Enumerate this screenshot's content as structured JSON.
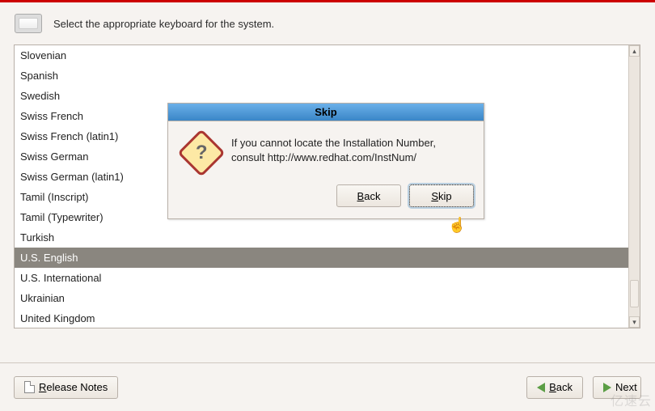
{
  "header": {
    "text": "Select the appropriate keyboard for the system."
  },
  "keyboard_list": {
    "items": [
      {
        "label": "Slovenian",
        "selected": false
      },
      {
        "label": "Spanish",
        "selected": false
      },
      {
        "label": "Swedish",
        "selected": false
      },
      {
        "label": "Swiss French",
        "selected": false
      },
      {
        "label": "Swiss French (latin1)",
        "selected": false
      },
      {
        "label": "Swiss German",
        "selected": false
      },
      {
        "label": "Swiss German (latin1)",
        "selected": false
      },
      {
        "label": "Tamil (Inscript)",
        "selected": false
      },
      {
        "label": "Tamil (Typewriter)",
        "selected": false
      },
      {
        "label": "Turkish",
        "selected": false
      },
      {
        "label": "U.S. English",
        "selected": true
      },
      {
        "label": "U.S. International",
        "selected": false
      },
      {
        "label": "Ukrainian",
        "selected": false
      },
      {
        "label": "United Kingdom",
        "selected": false
      }
    ]
  },
  "dialog": {
    "title": "Skip",
    "message": "If you cannot locate the Installation Number, consult http://www.redhat.com/InstNum/",
    "back_label": "Back",
    "skip_label": "Skip"
  },
  "footer": {
    "release_notes_label": "Release Notes",
    "back_label": "Back",
    "next_label": "Next"
  },
  "watermark": "亿速云"
}
